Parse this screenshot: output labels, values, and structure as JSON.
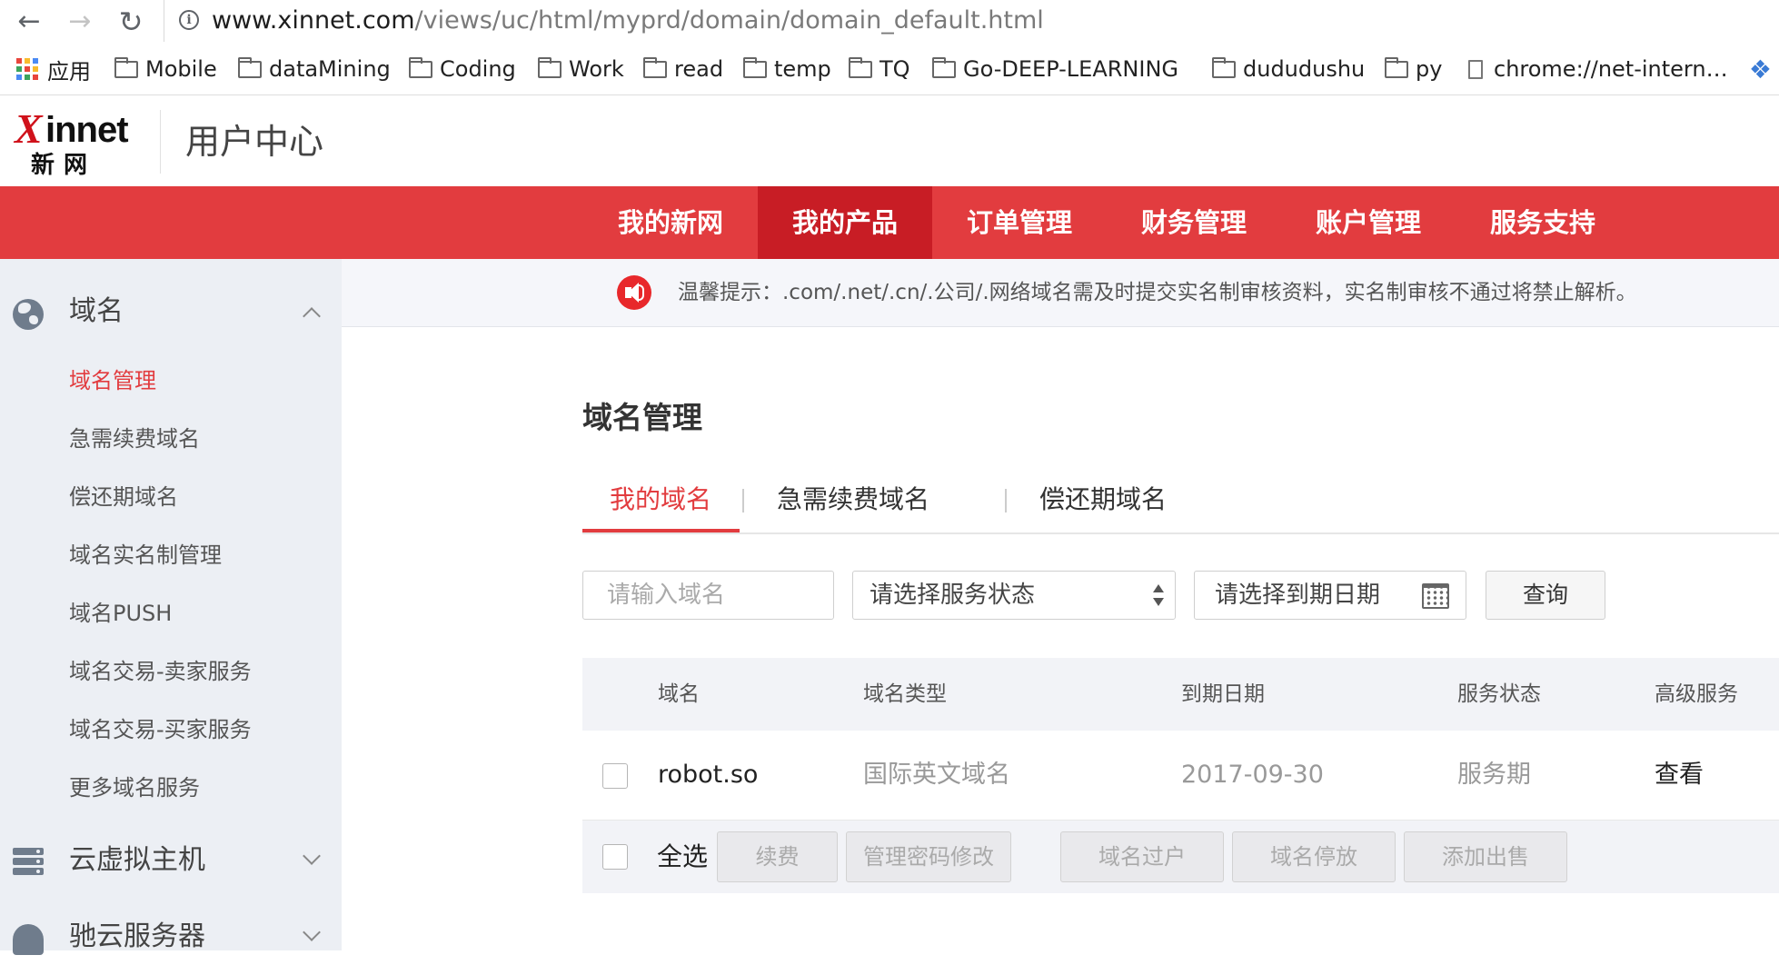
{
  "browser": {
    "url_host": "www.xinnet.com",
    "url_path": "/views/uc/html/myprd/domain/domain_default.html",
    "bookmarks": [
      {
        "label": "应用",
        "icon": "apps-grid-icon"
      },
      {
        "label": "Mobile",
        "icon": "folder-icon"
      },
      {
        "label": "dataMining",
        "icon": "folder-icon"
      },
      {
        "label": "Coding",
        "icon": "folder-icon"
      },
      {
        "label": "Work",
        "icon": "folder-icon"
      },
      {
        "label": "read",
        "icon": "folder-icon"
      },
      {
        "label": "temp",
        "icon": "folder-icon"
      },
      {
        "label": "TQ",
        "icon": "folder-icon"
      },
      {
        "label": "Go-DEEP-LEARNING",
        "icon": "folder-icon"
      },
      {
        "label": "dududushu",
        "icon": "folder-icon"
      },
      {
        "label": "py",
        "icon": "folder-icon"
      },
      {
        "label": "chrome://net-intern…",
        "icon": "page-icon"
      }
    ]
  },
  "header": {
    "logo_x": "X",
    "logo_innet": "innet",
    "logo_cn": "新网",
    "title": "用户中心"
  },
  "topnav": {
    "items": [
      "我的新网",
      "我的产品",
      "订单管理",
      "财务管理",
      "账户管理",
      "服务支持"
    ],
    "active_index": 1
  },
  "sidebar": {
    "groups": [
      {
        "label": "域名",
        "icon": "globe-icon",
        "expanded": true,
        "items": [
          "域名管理",
          "急需续费域名",
          "偿还期域名",
          "域名实名制管理",
          "域名PUSH",
          "域名交易-卖家服务",
          "域名交易-买家服务",
          "更多域名服务"
        ],
        "active_item": 0
      },
      {
        "label": "云虚拟主机",
        "icon": "server-icon",
        "expanded": false
      },
      {
        "label": "驰云服务器",
        "icon": "cloud-server-icon",
        "expanded": false
      }
    ]
  },
  "notice": {
    "text": "温馨提示：.com/.net/.cn/.公司/.网络域名需及时提交实名制审核资料，实名制审核不通过将禁止解析。"
  },
  "main": {
    "title": "域名管理",
    "tabs": [
      "我的域名",
      "急需续费域名",
      "偿还期域名"
    ],
    "active_tab": 0,
    "filters": {
      "domain_placeholder": "请输入域名",
      "status_select": "请选择服务状态",
      "date_placeholder": "请选择到期日期",
      "query_button": "查询"
    },
    "table": {
      "columns": [
        "域名",
        "域名类型",
        "到期日期",
        "服务状态",
        "高级服务"
      ],
      "rows": [
        {
          "domain": "robot.so",
          "type": "国际英文域名",
          "expiry": "2017-09-30",
          "status": "服务期",
          "service": "查看"
        }
      ],
      "footer": {
        "select_all": "全选",
        "actions": [
          "续费",
          "管理密码修改",
          "域名过户",
          "域名停放",
          "添加出售"
        ]
      }
    }
  },
  "colors": {
    "brand_red": "#e23c3f",
    "nav_active_red": "#c81d25",
    "sidebar_bg": "#eceff4"
  }
}
